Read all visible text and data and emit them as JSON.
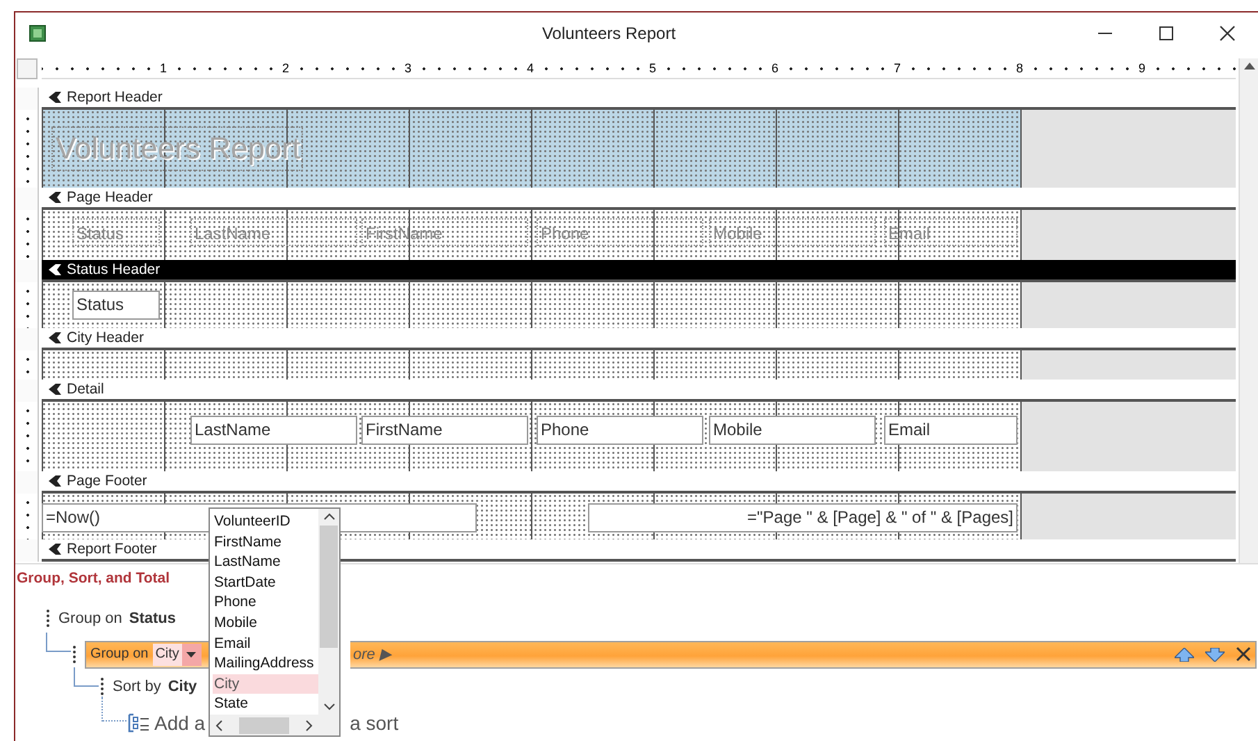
{
  "window": {
    "title": "Volunteers Report"
  },
  "ruler": {
    "marks": [
      "1",
      "2",
      "3",
      "4",
      "5",
      "6",
      "7",
      "8",
      "9"
    ]
  },
  "sections": [
    {
      "label": "Report Header",
      "selected": false,
      "shaded": true,
      "controls": [
        {
          "kind": "title",
          "text": "Volunteers Report"
        }
      ]
    },
    {
      "label": "Page Header",
      "selected": false,
      "controls": [
        {
          "kind": "label",
          "text": "Status"
        },
        {
          "kind": "label",
          "text": "LastName"
        },
        {
          "kind": "label",
          "text": "FirstName"
        },
        {
          "kind": "label",
          "text": "Phone"
        },
        {
          "kind": "label",
          "text": "Mobile"
        },
        {
          "kind": "label",
          "text": "Email"
        }
      ]
    },
    {
      "label": "Status Header",
      "selected": true,
      "controls": [
        {
          "kind": "textbox",
          "text": "Status"
        }
      ]
    },
    {
      "label": "City Header",
      "selected": false
    },
    {
      "label": "Detail",
      "selected": false,
      "controls": [
        {
          "kind": "textbox",
          "text": "LastName"
        },
        {
          "kind": "textbox",
          "text": "FirstName"
        },
        {
          "kind": "textbox",
          "text": "Phone"
        },
        {
          "kind": "textbox",
          "text": "Mobile"
        },
        {
          "kind": "textbox",
          "text": "Email"
        }
      ]
    },
    {
      "label": "Page Footer",
      "selected": false,
      "controls": [
        {
          "kind": "textbox",
          "text": "=Now()"
        },
        {
          "kind": "expression",
          "text": "=\"Page \" & [Page] & \" of \" & [Pages]"
        }
      ]
    },
    {
      "label": "Report Footer",
      "selected": false
    }
  ],
  "group_sort_total": {
    "title": "Group, Sort, and Total",
    "levels": [
      {
        "kind": "group",
        "prefix": "Group on",
        "field": "Status",
        "selected": false,
        "children": [
          {
            "kind": "group",
            "prefix": "Group on",
            "field": "City",
            "selected": true,
            "more": "ore ▶",
            "children": [
              {
                "kind": "sort",
                "prefix": "Sort by",
                "field": "City",
                "selected": false
              }
            ]
          }
        ]
      }
    ],
    "add_row": {
      "left": "Add a",
      "right": "a sort"
    }
  },
  "field_list": {
    "items": [
      {
        "label": "VolunteerID",
        "selected": false
      },
      {
        "label": "FirstName",
        "selected": false
      },
      {
        "label": "LastName",
        "selected": false
      },
      {
        "label": "StartDate",
        "selected": false
      },
      {
        "label": "Phone",
        "selected": false
      },
      {
        "label": "Mobile",
        "selected": false
      },
      {
        "label": "Email",
        "selected": false
      },
      {
        "label": "MailingAddress",
        "selected": false
      },
      {
        "label": "City",
        "selected": true
      },
      {
        "label": "State",
        "selected": false
      }
    ]
  }
}
